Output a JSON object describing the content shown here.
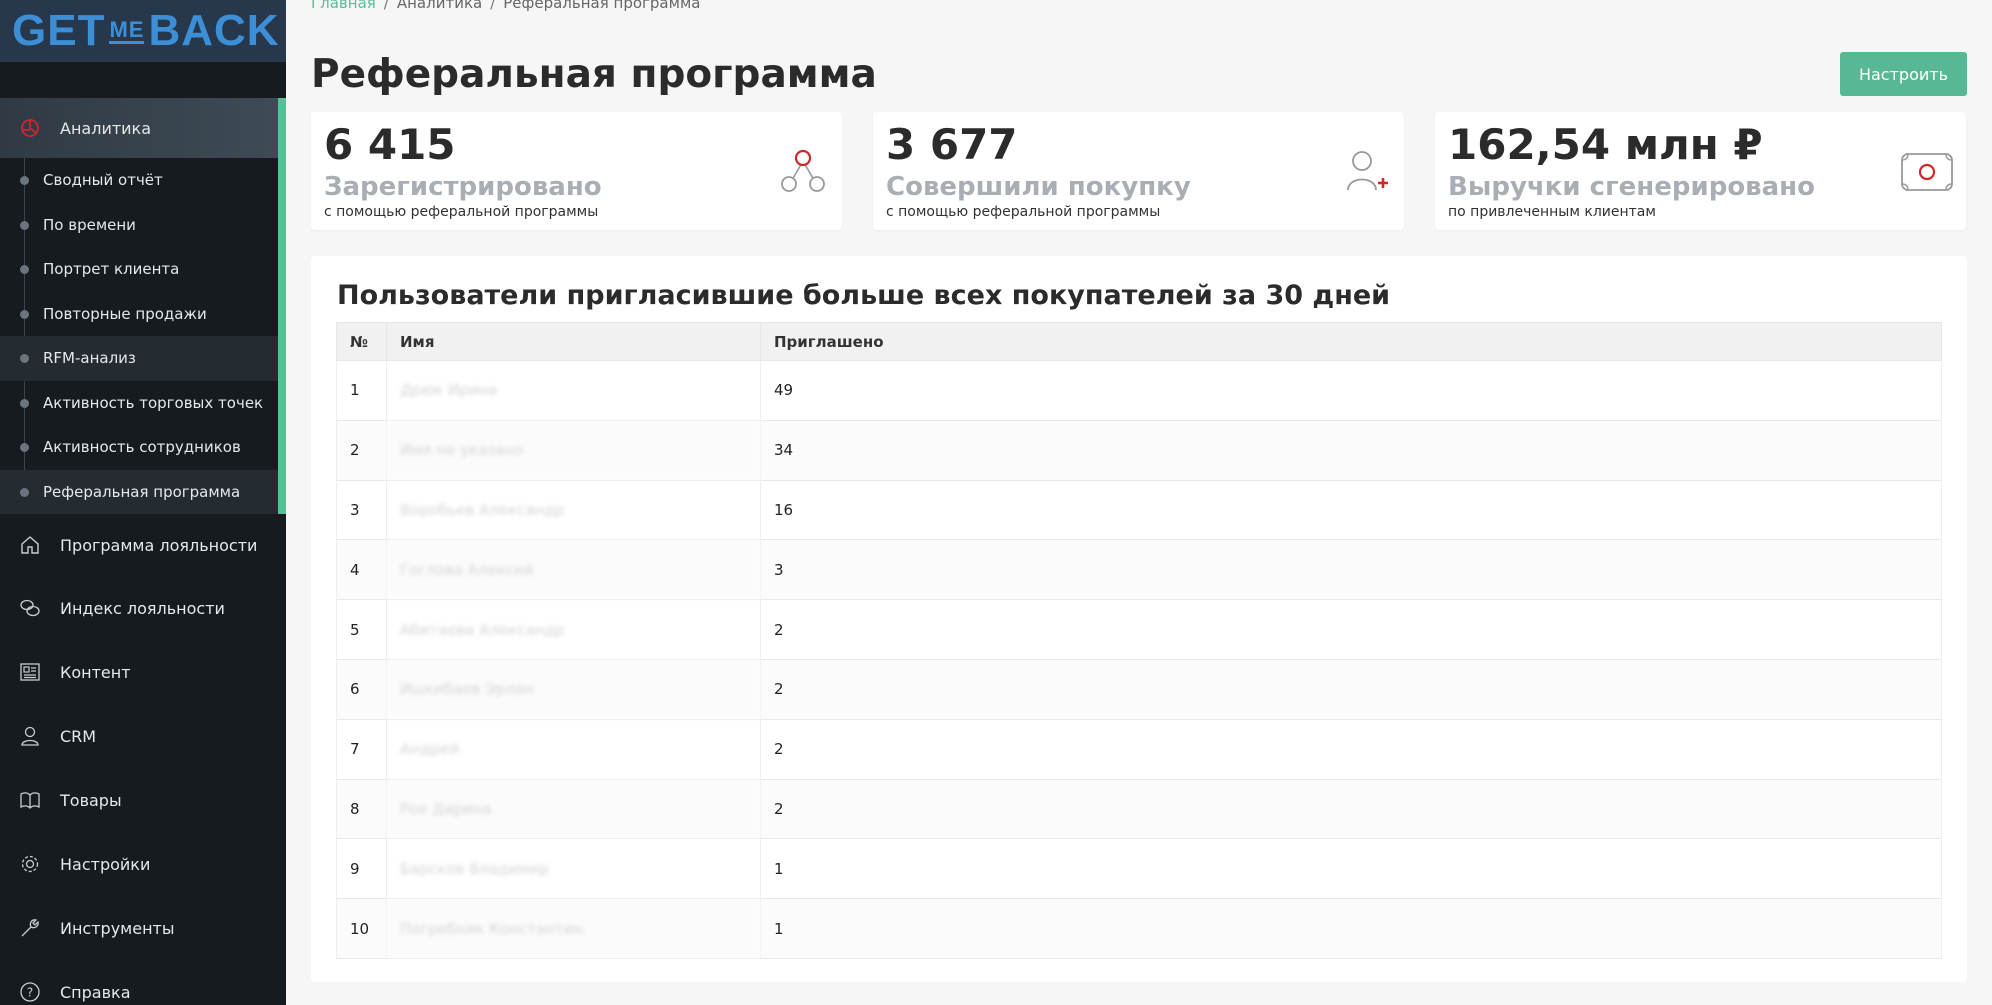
{
  "logo": {
    "left": "GET",
    "mid": "ME",
    "right": "BACK"
  },
  "sidebar": {
    "active": {
      "label": "Аналитика",
      "icon": "analytics-icon"
    },
    "sub_items": [
      "Сводный отчёт",
      "По времени",
      "Портрет клиента",
      "Повторные продажи",
      "RFM-анализ",
      "Активность торговых точек",
      "Активность сотрудников",
      "Реферальная программа"
    ],
    "items": [
      {
        "label": "Программа лояльности",
        "icon": "home-icon"
      },
      {
        "label": "Индекс лояльности",
        "icon": "chat-icon"
      },
      {
        "label": "Контент",
        "icon": "newspaper-icon"
      },
      {
        "label": "CRM",
        "icon": "user-icon"
      },
      {
        "label": "Товары",
        "icon": "book-icon"
      },
      {
        "label": "Настройки",
        "icon": "gear-icon"
      },
      {
        "label": "Инструменты",
        "icon": "wrench-icon"
      },
      {
        "label": "Справка",
        "icon": "help-icon"
      }
    ]
  },
  "breadcrumb": {
    "home": "Главная",
    "section": "Аналитика",
    "current": "Реферальная программа",
    "sep": "/"
  },
  "page_title": "Реферальная программа",
  "setup_button": "Настроить",
  "cards": [
    {
      "value": "6 415",
      "label": "Зарегистрировано",
      "sub": "с помощью реферальной программы",
      "icon": "referral-network-icon"
    },
    {
      "value": "3 677",
      "label": "Совершили покупку",
      "sub": "с помощью реферальной программы",
      "icon": "user-plus-icon"
    },
    {
      "value": "162,54 млн ₽",
      "label": "Выручки сгенерировано",
      "sub": "по привлеченным клиентам",
      "icon": "money-icon"
    }
  ],
  "table": {
    "title": "Пользователи пригласившие больше всех покупателей за 30 дней",
    "headers": [
      "№",
      "Имя",
      "Приглашено"
    ],
    "rows": [
      {
        "n": "1",
        "name": "Дрюк Ирина",
        "count": "49"
      },
      {
        "n": "2",
        "name": "Имя не указано",
        "count": "34"
      },
      {
        "n": "3",
        "name": "Воробьев Александр",
        "count": "16"
      },
      {
        "n": "4",
        "name": "Гоглова Алексей",
        "count": "3"
      },
      {
        "n": "5",
        "name": "Абитаева Александр",
        "count": "2"
      },
      {
        "n": "6",
        "name": "Ишкибаев Эрлан",
        "count": "2"
      },
      {
        "n": "7",
        "name": "Андрей",
        "count": "2"
      },
      {
        "n": "8",
        "name": "Рое Дарина",
        "count": "2"
      },
      {
        "n": "9",
        "name": "Барсков Владимир",
        "count": "1"
      },
      {
        "n": "10",
        "name": "Погребняк Константин",
        "count": "1"
      }
    ]
  },
  "colors": {
    "accent": "#58c095",
    "sidebar_bg": "#161b20",
    "logo": "#3c8fd6",
    "alert": "#d0262b"
  }
}
